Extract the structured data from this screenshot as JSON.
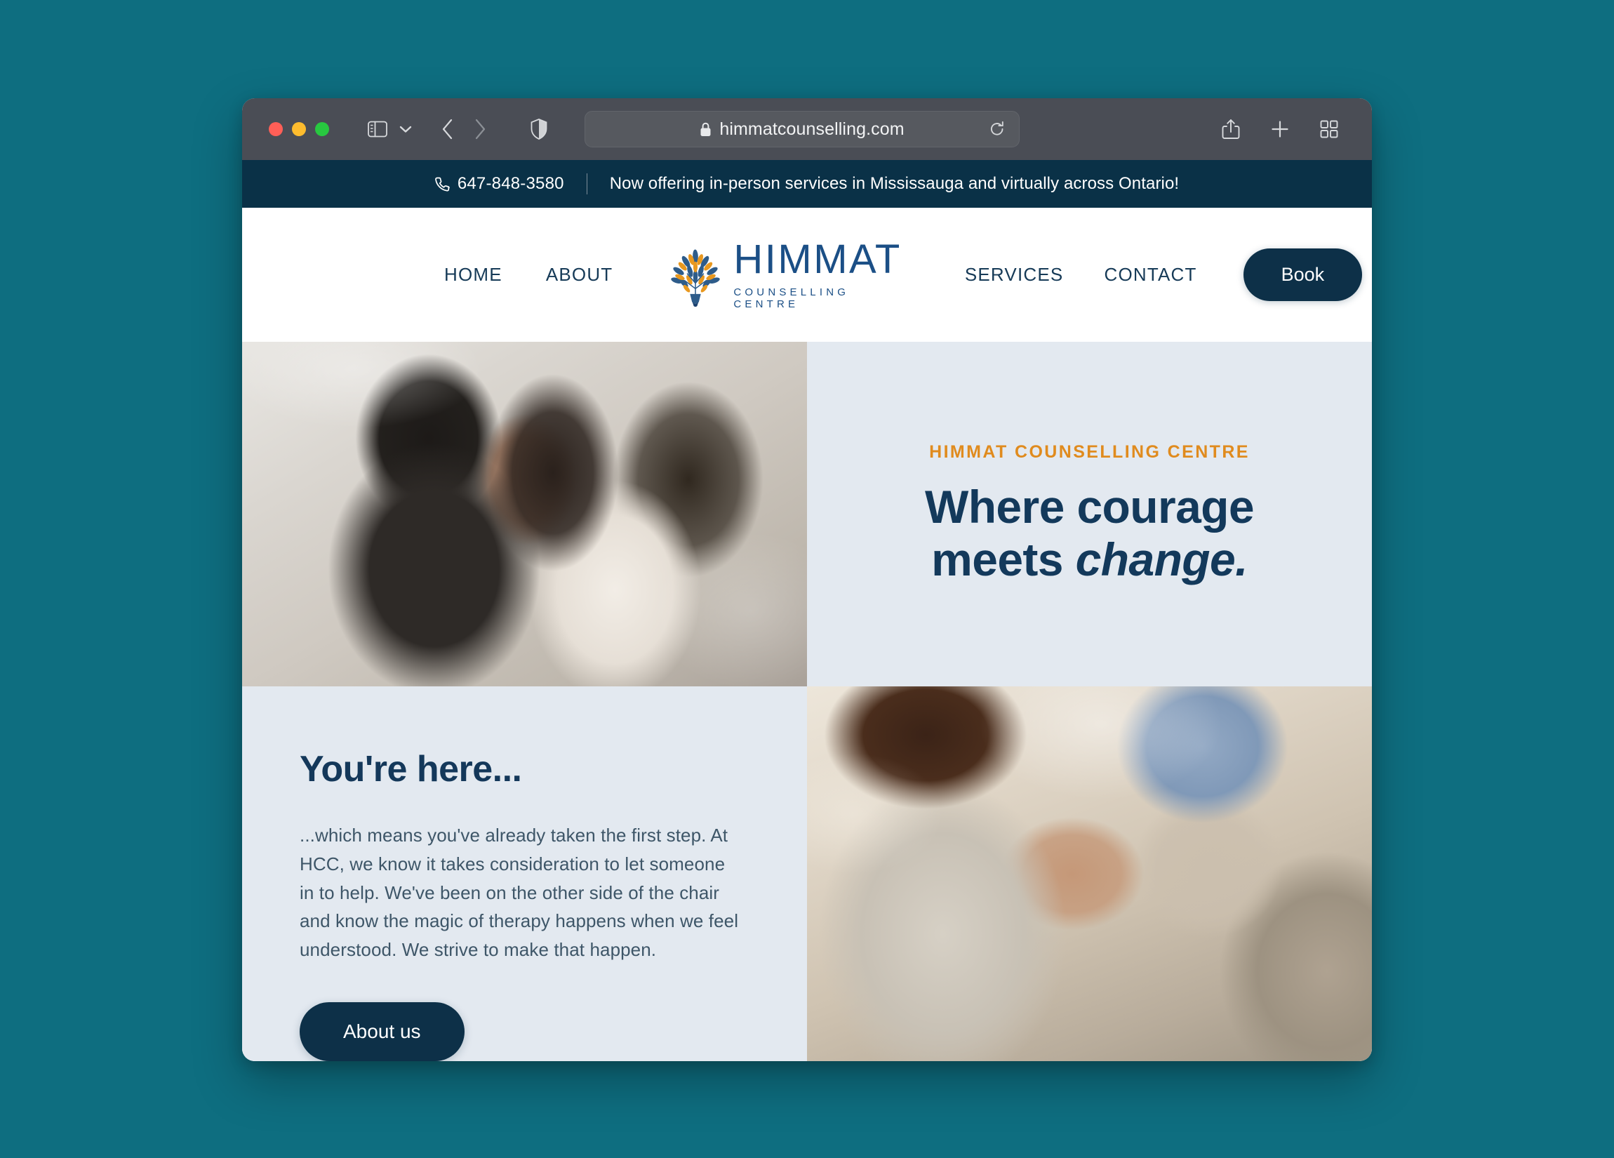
{
  "browser": {
    "url": "himmatcounselling.com",
    "icons": {
      "sidebar": "sidebar-icon",
      "tab_group_chevron": "chevron-down-icon",
      "back": "back-arrow-icon",
      "forward": "forward-arrow-icon",
      "shield": "shield-icon",
      "lock": "lock-icon",
      "reload": "reload-icon",
      "share": "share-icon",
      "new_tab": "plus-icon",
      "tab_overview": "tab-overview-icon"
    },
    "traffic_lights": {
      "close": "#FF5F57",
      "minimize": "#FEBC2E",
      "maximize": "#28C840"
    }
  },
  "announcement": {
    "phone": "647-848-3580",
    "phone_icon": "phone-icon",
    "message": "Now offering in-person services in Mississauga and virtually across Ontario!",
    "background": "#0A3147"
  },
  "nav": {
    "links_left": [
      {
        "label": "HOME"
      },
      {
        "label": "ABOUT"
      }
    ],
    "links_right": [
      {
        "label": "SERVICES"
      },
      {
        "label": "CONTACT"
      }
    ],
    "cta_label": "Book",
    "cta_color": "#0D3048"
  },
  "logo": {
    "title": "HIMMAT",
    "subtitle": "COUNSELLING CENTRE",
    "mark": "tree-bouquet-icon",
    "brand_blue": "#1B4F86",
    "brand_orange": "#E8981F"
  },
  "hero": {
    "eyebrow": "HIMMAT COUNSELLING CENTRE",
    "title_part1": "Where courage",
    "title_part2": "meets ",
    "title_emphasis": "change.",
    "panel_background": "#E3E9F0",
    "accent_orange": "#E08B1E",
    "title_color": "#13395B",
    "photo": "couple-on-couch-photo"
  },
  "intro": {
    "title": "You're here...",
    "body": "...which means you've already taken the first step. At HCC, we know it takes consideration to let someone in to help. We've been on the other side of the chair and know the magic of therapy happens when we feel understood. We strive to make that happen.",
    "cta_label": "About us",
    "photo": "therapy-group-session-photo"
  },
  "page_background": "#0E6E80"
}
